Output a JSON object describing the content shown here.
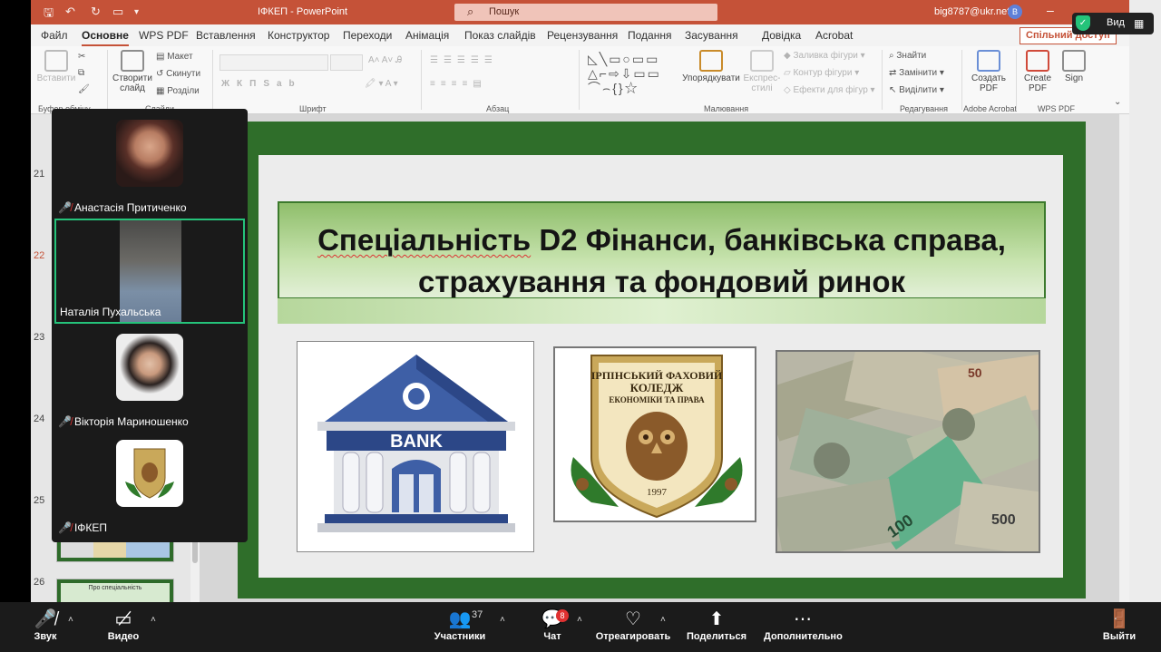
{
  "powerpoint": {
    "doc_title": "ІФКЕП",
    "app_name": "PowerPoint",
    "search_placeholder": "Пошук",
    "account_email": "big8787@ukr.net",
    "avatar_initial": "B",
    "share_label": "Спільний доступ",
    "tabs": [
      "Файл",
      "Основне",
      "WPS PDF",
      "Вставлення",
      "Конструктор",
      "Переходи",
      "Анімація",
      "Показ слайдів",
      "Рецензування",
      "Подання",
      "Засування",
      "Довідка",
      "Acrobat"
    ],
    "ribbon": {
      "paste": "Вставити",
      "clipboard_group": "Буфер обміну",
      "new_slide": "Створити слайд",
      "layout": "Макет",
      "reset": "Скинути",
      "sections": "Розділи",
      "slides_group": "Слайди",
      "font_group": "Шрифт",
      "paragraph_group": "Абзац",
      "arrange": "Упорядкувати",
      "quick_styles": "Експрес-стилі",
      "shape_fill": "Заливка фігури",
      "shape_outline": "Контур фігури",
      "shape_effects": "Ефекти для фігур",
      "drawing_group": "Малювання",
      "find": "Знайти",
      "replace": "Замінити",
      "select": "Виділити",
      "editing_group": "Редагування",
      "create_pdf": "Создать PDF",
      "adobe_group": "Adobe Acrobat",
      "create_pdf_wps": "Create PDF",
      "sign": "Sign",
      "wps_group": "WPS PDF"
    },
    "slide_numbers": [
      "21",
      "22",
      "23",
      "24",
      "25",
      "26"
    ],
    "thumb_26_caption": "Про спеціальність",
    "slide": {
      "title_line1_a": "Спеціальність",
      "title_line1_b": " D2 Фінанси, банківська справа,",
      "title_line2": "страхування та фондовий ринок",
      "bank_label": "BANK",
      "college_line1": "ІРПІНСЬКИЙ ФАХОВИЙ",
      "college_line2": "КОЛЕДЖ",
      "college_line3": "ЕКОНОМІКИ ТА ПРАВА",
      "college_year": "1997",
      "money_labels": [
        "50",
        "100",
        "500"
      ]
    }
  },
  "zoom": {
    "view_label": "Вид",
    "participants": [
      {
        "name": "Анастасія Притиченко",
        "muted": true
      },
      {
        "name": "Наталія Пухальська",
        "muted": false
      },
      {
        "name": "Вікторія Мариношенко",
        "muted": true
      },
      {
        "name": "ІФКЕП",
        "muted": true
      }
    ],
    "toolbar": {
      "audio": "Звук",
      "video": "Видео",
      "participants": "Участники",
      "participants_count": "37",
      "chat": "Чат",
      "chat_badge": "8",
      "react": "Отреагировать",
      "share": "Поделиться",
      "more": "Дополнительно",
      "leave": "Выйти"
    },
    "colors": {
      "accent_green": "#25c37a",
      "muted_red": "#e03131",
      "ppt_brand": "#c55238"
    }
  }
}
